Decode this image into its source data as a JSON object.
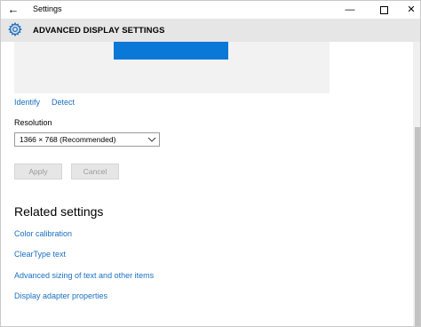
{
  "window": {
    "title": "Settings",
    "back_glyph": "←",
    "minimize_glyph": "—",
    "close_glyph": "✕"
  },
  "header": {
    "title": "ADVANCED DISPLAY SETTINGS",
    "icon": "gear-icon",
    "accent": "#1a6fc0"
  },
  "display": {
    "monitor_color": "#0a78d7",
    "identify_label": "Identify",
    "detect_label": "Detect"
  },
  "resolution": {
    "label": "Resolution",
    "selected": "1366 × 768 (Recommended)"
  },
  "actions": {
    "apply_label": "Apply",
    "cancel_label": "Cancel"
  },
  "related": {
    "heading": "Related settings",
    "links": [
      "Color calibration",
      "ClearType text",
      "Advanced sizing of text and other items",
      "Display adapter properties"
    ]
  }
}
